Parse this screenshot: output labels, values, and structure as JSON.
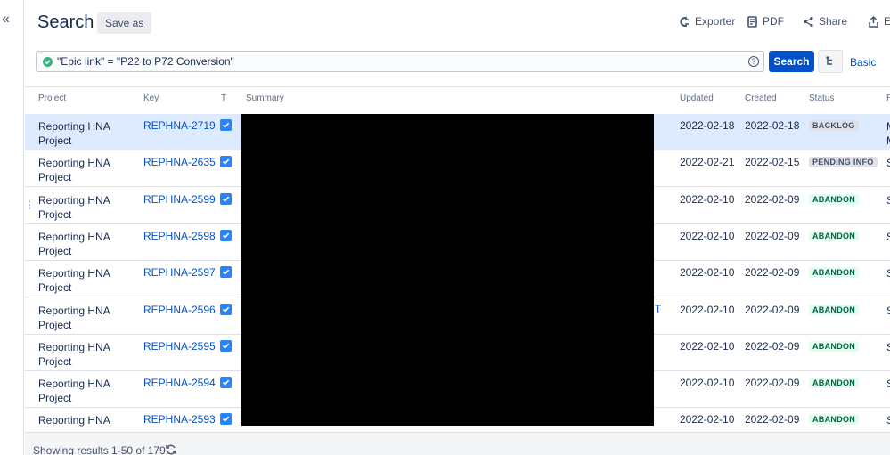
{
  "header": {
    "title": "Search",
    "save_as": "Save as",
    "actions": {
      "exporter": "Exporter",
      "pdf": "PDF",
      "share": "Share",
      "export": "Ex"
    }
  },
  "query": {
    "text": "\"Epic link\" = \"P22 to P72 Conversion\"",
    "search_label": "Search",
    "basic_label": "Basic",
    "help_glyph": "?"
  },
  "columns": {
    "project": "Project",
    "key": "Key",
    "type": "T",
    "summary": "Summary",
    "updated": "Updated",
    "created": "Created",
    "status": "Status",
    "extra": "R"
  },
  "rows": [
    {
      "project": "Reporting HNA Project",
      "key": "REPHNA-2719",
      "updated": "2022-02-18",
      "created": "2022-02-18",
      "status": "BACKLOG",
      "extra": "M M"
    },
    {
      "project": "Reporting HNA Project",
      "key": "REPHNA-2635",
      "updated": "2022-02-21",
      "created": "2022-02-15",
      "status": "PENDING INFO",
      "extra": "S"
    },
    {
      "project": "Reporting HNA Project",
      "key": "REPHNA-2599",
      "updated": "2022-02-10",
      "created": "2022-02-09",
      "status": "ABANDON",
      "extra": "S"
    },
    {
      "project": "Reporting HNA Project",
      "key": "REPHNA-2598",
      "updated": "2022-02-10",
      "created": "2022-02-09",
      "status": "ABANDON",
      "extra": "S"
    },
    {
      "project": "Reporting HNA Project",
      "key": "REPHNA-2597",
      "updated": "2022-02-10",
      "created": "2022-02-09",
      "status": "ABANDON",
      "extra": "S"
    },
    {
      "project": "Reporting HNA Project",
      "key": "REPHNA-2596",
      "updated": "2022-02-10",
      "created": "2022-02-09",
      "status": "ABANDON",
      "extra": "S"
    },
    {
      "project": "Reporting HNA Project",
      "key": "REPHNA-2595",
      "updated": "2022-02-10",
      "created": "2022-02-09",
      "status": "ABANDON",
      "extra": "S"
    },
    {
      "project": "Reporting HNA Project",
      "key": "REPHNA-2594",
      "updated": "2022-02-10",
      "created": "2022-02-09",
      "status": "ABANDON",
      "extra": "S"
    },
    {
      "project": "Reporting HNA Project",
      "key": "REPHNA-2593",
      "updated": "2022-02-10",
      "created": "2022-02-09",
      "status": "ABANDON",
      "extra": "S"
    }
  ],
  "summary_fragment": "T",
  "footer": {
    "showing": "Showing results 1-50 of 179"
  },
  "colors": {
    "primary": "#0052cc",
    "selected_row": "#deebff",
    "type_icon": "#2684ff",
    "status_done_bg": "#e3fcef",
    "status_done_text": "#006644",
    "status_default_bg": "#dfe1e6"
  },
  "icons": {
    "collapse": "double-chevron-left-icon",
    "exporter": "exporter-icon",
    "pdf": "pdf-icon",
    "share": "share-icon",
    "export": "export-icon",
    "query_valid": "check-circle-icon",
    "help": "help-icon",
    "tree": "tree-view-icon",
    "type": "checkbox-task-icon",
    "refresh": "refresh-icon"
  }
}
